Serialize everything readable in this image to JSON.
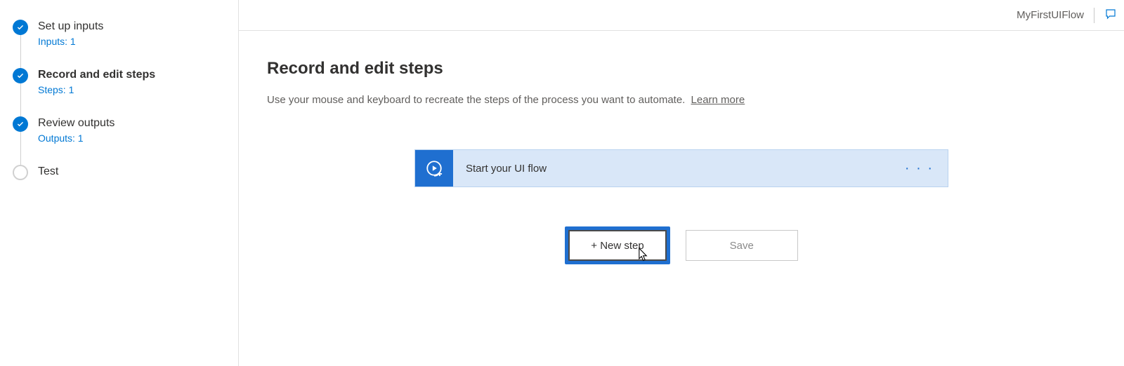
{
  "header": {
    "flow_name": "MyFirstUIFlow"
  },
  "sidebar": {
    "steps": [
      {
        "title": "Set up inputs",
        "sub": "Inputs: 1",
        "status": "done"
      },
      {
        "title": "Record and edit steps",
        "sub": "Steps: 1",
        "status": "done",
        "active": true
      },
      {
        "title": "Review outputs",
        "sub": "Outputs: 1",
        "status": "done"
      },
      {
        "title": "Test",
        "sub": "",
        "status": "pending"
      }
    ]
  },
  "main": {
    "title": "Record and edit steps",
    "description": "Use your mouse and keyboard to recreate the steps of the process you want to automate.",
    "learn_more": "Learn more"
  },
  "flow": {
    "start_card_label": "Start your UI flow"
  },
  "buttons": {
    "new_step": "+ New step",
    "save": "Save"
  }
}
